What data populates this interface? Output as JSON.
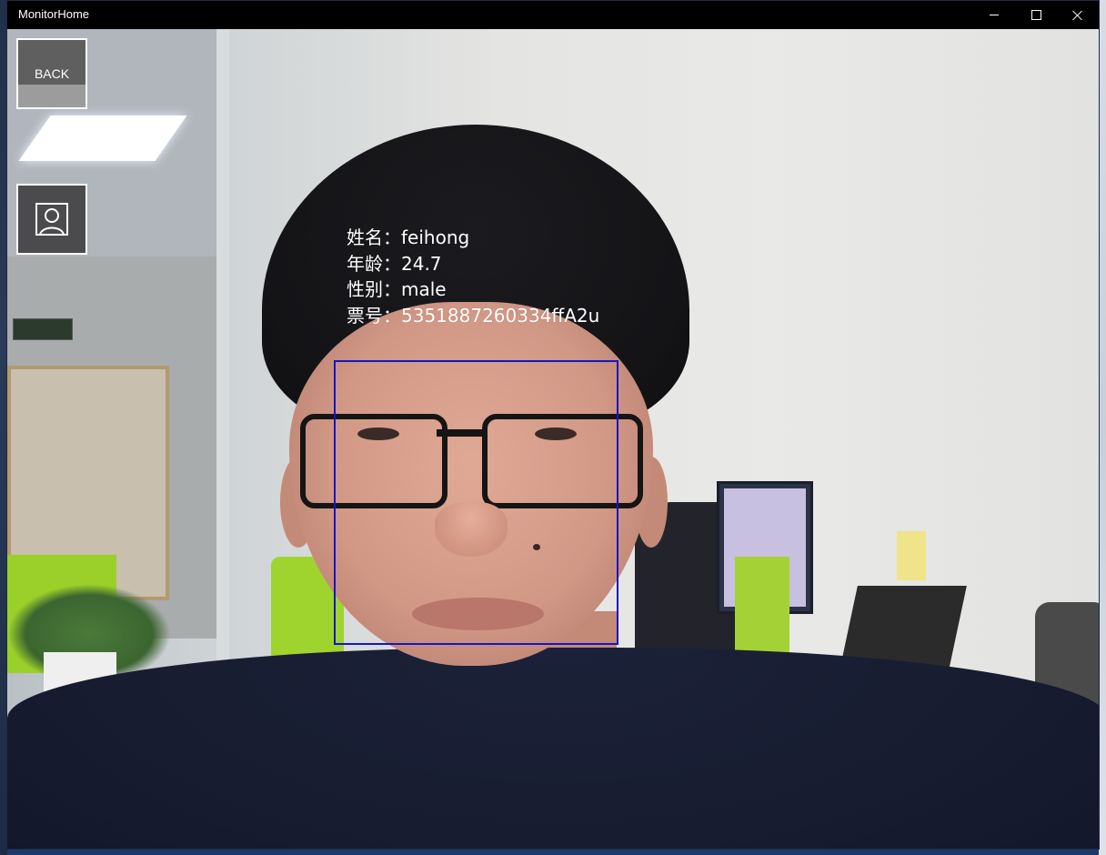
{
  "window": {
    "title": "MonitorHome",
    "controls": {
      "minimize_icon": "minimize-icon",
      "maximize_icon": "maximize-icon",
      "close_icon": "close-icon"
    }
  },
  "sidebar": {
    "back_label": "BACK",
    "user_icon": "user-portrait-icon"
  },
  "detection": {
    "box_color": "#1515c8",
    "info": [
      {
        "label": "姓名：",
        "value": "feihong"
      },
      {
        "label": "年龄：",
        "value": "24.7"
      },
      {
        "label": "性别：",
        "value": "male"
      },
      {
        "label": "票号：",
        "value": "5351887260334ffA2u"
      }
    ]
  },
  "colors": {
    "titlebar": "#000000",
    "button_border": "#ffffff",
    "info_text": "#ffffff"
  }
}
